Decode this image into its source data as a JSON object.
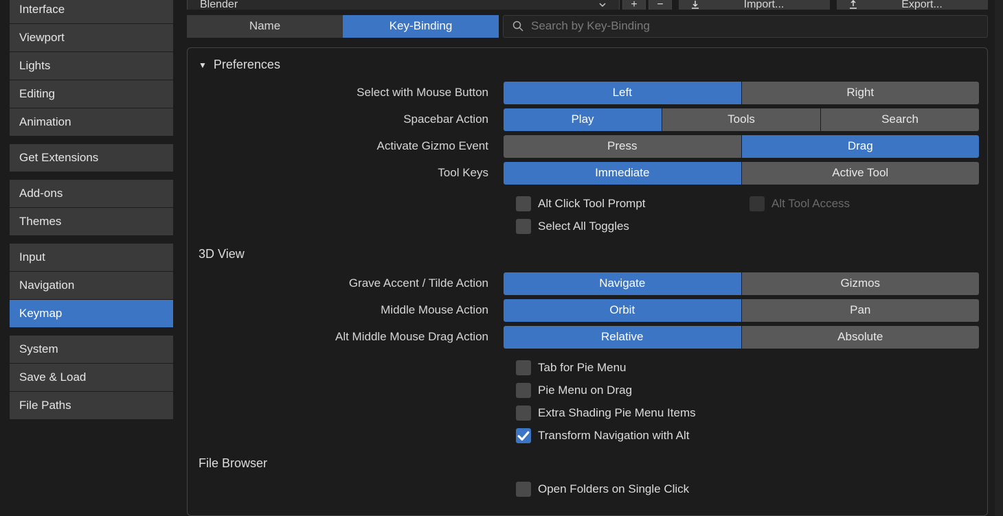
{
  "sidebar": {
    "groups": [
      {
        "items": [
          "Interface",
          "Viewport",
          "Lights",
          "Editing",
          "Animation"
        ]
      },
      {
        "items": [
          "Get Extensions"
        ]
      },
      {
        "items": [
          "Add-ons",
          "Themes"
        ]
      },
      {
        "items": [
          "Input",
          "Navigation",
          "Keymap"
        ]
      },
      {
        "items": [
          "System",
          "Save & Load",
          "File Paths"
        ]
      }
    ],
    "active": "Keymap"
  },
  "top": {
    "preset": "Blender",
    "import": "Import...",
    "export": "Export..."
  },
  "tabs": {
    "name": "Name",
    "keybinding": "Key-Binding",
    "search_placeholder": "Search by Key-Binding"
  },
  "prefs": {
    "title": "Preferences",
    "rows": [
      {
        "label": "Select with Mouse Button",
        "options": [
          "Left",
          "Right"
        ],
        "active": 0
      },
      {
        "label": "Spacebar Action",
        "options": [
          "Play",
          "Tools",
          "Search"
        ],
        "active": 0
      },
      {
        "label": "Activate Gizmo Event",
        "options": [
          "Press",
          "Drag"
        ],
        "active": 1
      },
      {
        "label": "Tool Keys",
        "options": [
          "Immediate",
          "Active Tool"
        ],
        "active": 0
      }
    ],
    "checks1": [
      {
        "label": "Alt Click Tool Prompt",
        "checked": false,
        "disabled": false
      },
      {
        "label": "Alt Tool Access",
        "checked": false,
        "disabled": true
      }
    ],
    "checks1b": [
      {
        "label": "Select All Toggles",
        "checked": false
      }
    ],
    "view3d_title": "3D View",
    "view3d_rows": [
      {
        "label": "Grave Accent / Tilde Action",
        "options": [
          "Navigate",
          "Gizmos"
        ],
        "active": 0
      },
      {
        "label": "Middle Mouse Action",
        "options": [
          "Orbit",
          "Pan"
        ],
        "active": 0
      },
      {
        "label": "Alt Middle Mouse Drag Action",
        "options": [
          "Relative",
          "Absolute"
        ],
        "active": 0
      }
    ],
    "checks2": [
      {
        "label": "Tab for Pie Menu",
        "checked": false
      },
      {
        "label": "Pie Menu on Drag",
        "checked": false
      },
      {
        "label": "Extra Shading Pie Menu Items",
        "checked": false
      },
      {
        "label": "Transform Navigation with Alt",
        "checked": true
      }
    ],
    "filebrowser_title": "File Browser",
    "checks3": [
      {
        "label": "Open Folders on Single Click",
        "checked": false
      }
    ]
  }
}
